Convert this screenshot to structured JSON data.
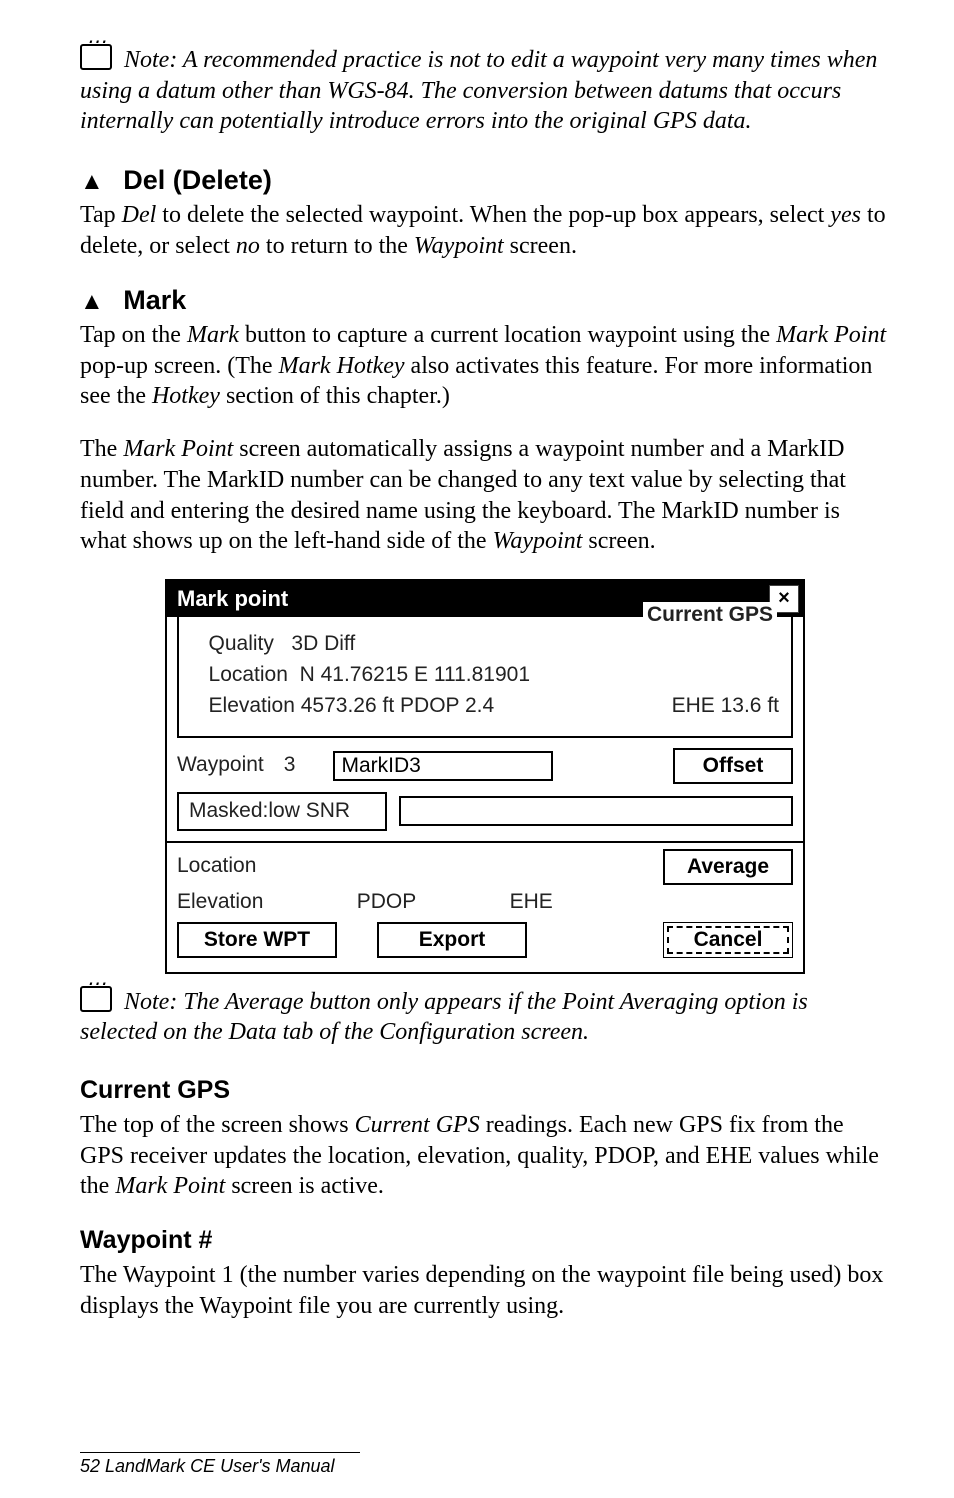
{
  "note1": "Note: A recommended practice is not to edit a waypoint very many times when using a datum other than WGS-84. The conversion between datums that occurs internally can potentially introduce errors into the original GPS data.",
  "del": {
    "heading": "Del (Delete)",
    "body_pre": "Tap ",
    "body_i1": "Del",
    "body_mid1": " to delete the selected waypoint. When the pop-up box appears, select ",
    "body_i2": "yes",
    "body_mid2": " to delete, or select ",
    "body_i3": "no",
    "body_mid3": " to return to the ",
    "body_i4": "Waypoint",
    "body_post": " screen."
  },
  "mark": {
    "heading": "Mark",
    "p1_a": "Tap on the ",
    "p1_i1": "Mark",
    "p1_b": " button to capture a current location waypoint using the ",
    "p1_i2": "Mark Point",
    "p1_c": " pop-up screen. (The ",
    "p1_i3": "Mark Hotkey",
    "p1_d": " also activates this feature. For more information see the ",
    "p1_i4": "Hotkey",
    "p1_e": " section of this chapter.)",
    "p2_a": "The ",
    "p2_i1": "Mark Point",
    "p2_b": " screen automatically assigns a waypoint number and a MarkID number. The MarkID number can be changed to any text value by selecting that field and entering the desired name using the keyboard. The MarkID number is what shows up on the left-hand side of the ",
    "p2_i2": "Waypoint",
    "p2_c": " screen."
  },
  "dialog": {
    "title": "Mark point",
    "legend": "Current GPS",
    "quality_label": "Quality",
    "quality_value": "3D Diff",
    "location_label": "Location",
    "location_value": "N 41.76215   E 111.81901",
    "elevation_label": "Elevation",
    "elevation_value": "4573.26 ft",
    "pdop_label": "PDOP",
    "pdop_value": "2.4",
    "ehe_label": "EHE",
    "ehe_value": "13.6 ft",
    "waypoint_label": "Waypoint",
    "waypoint_value": "3",
    "markid_value": "MarkID3",
    "offset_btn": "Offset",
    "masked_label": "Masked:low SNR",
    "loc_label": "Location",
    "average_btn": "Average",
    "elev_label": "Elevation",
    "pdop2_label": "PDOP",
    "ehe2_label": "EHE",
    "store_btn": "Store WPT",
    "export_btn": "Export",
    "cancel_btn": "Cancel"
  },
  "note2": "Note: The Average button only appears if the Point Averaging option is selected on the Data tab of the Configuration screen.",
  "currentGPS": {
    "heading": "Current GPS",
    "a": "The top of the screen shows ",
    "i1": "Current GPS",
    "b": " readings. Each new GPS fix from the GPS receiver updates the location, elevation, quality, PDOP, and EHE values while the ",
    "i2": "Mark Point",
    "c": " screen is active."
  },
  "waypointNum": {
    "heading": "Waypoint #",
    "body": "The Waypoint 1 (the number varies depending on the waypoint file being used) box displays the Waypoint file you are currently using."
  },
  "footer": "52  LandMark CE User's Manual"
}
